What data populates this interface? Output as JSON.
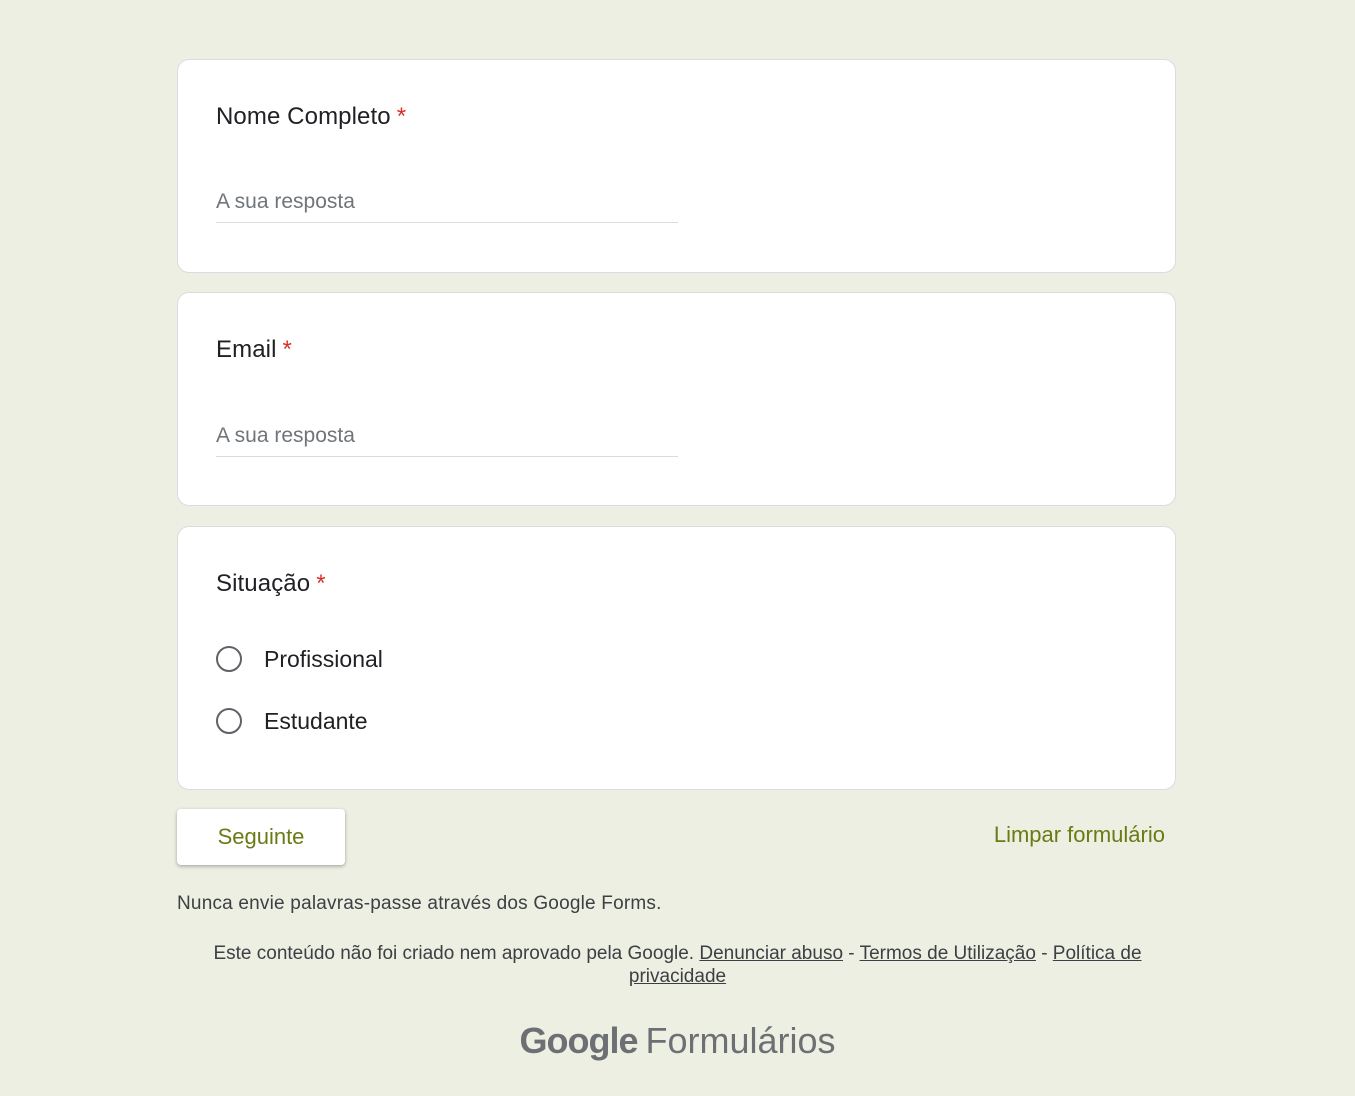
{
  "questions": {
    "name": {
      "title": "Nome Completo",
      "required_mark": "*",
      "placeholder": "A sua resposta"
    },
    "email": {
      "title": "Email",
      "required_mark": "*",
      "placeholder": "A sua resposta"
    },
    "situation": {
      "title": "Situação",
      "required_mark": "*",
      "options": [
        "Profissional",
        "Estudante"
      ]
    }
  },
  "actions": {
    "next_label": "Seguinte",
    "clear_label": "Limpar formulário"
  },
  "footer": {
    "warning": "Nunca envie palavras-passe através dos Google Forms.",
    "disclaimer": "Este conteúdo não foi criado nem aprovado pela Google.",
    "report_abuse": "Denunciar abuso",
    "separator": "-",
    "terms": "Termos de Utilização",
    "privacy": "Política de privacidade",
    "brand_google": "Google",
    "brand_product": "Formulários"
  },
  "colors": {
    "background": "#edefe3",
    "accent": "#6b7a14",
    "required": "#d93025"
  }
}
